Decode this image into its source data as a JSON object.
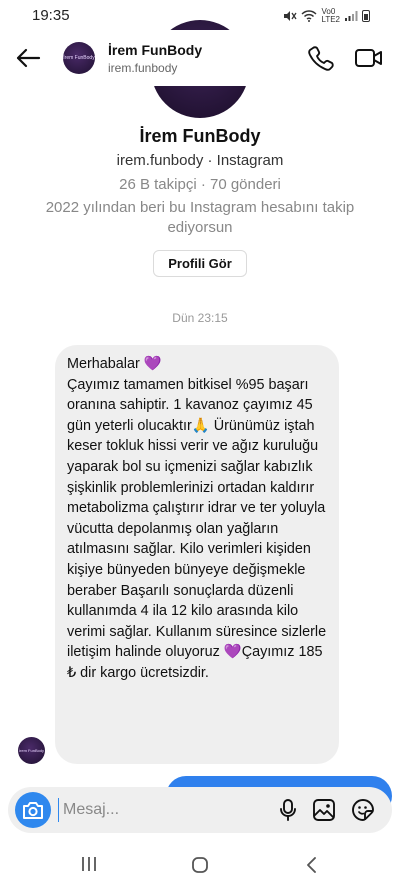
{
  "status_bar": {
    "time": "19:35",
    "network_top": "Vo0",
    "network_bottom": "LTE2"
  },
  "header": {
    "name": "İrem FunBody",
    "username": "irem.funbody",
    "avatar_text": "İrem FunBody",
    "icons": [
      "back-arrow-icon",
      "phone-icon",
      "video-camera-icon"
    ]
  },
  "profile": {
    "name": "İrem FunBody",
    "subtitle": "irem.funbody · Instagram",
    "stats": "26 B takipçi · 70 gönderi",
    "follow_since": "2022 yılından beri bu Instagram hesabını takip ediyorsun",
    "view_profile_label": "Profili Gör"
  },
  "conversation": {
    "timestamp": "Dün 23:15",
    "messages": [
      {
        "sender": "İrem FunBody",
        "text": "Merhabalar 💜\nÇayımız tamamen bitkisel %95 başarı oranına sahiptir. 1 kavanoz çayımız 45 gün yeterli olucaktır🙏 Ürünümüz   iştah keser tokluk hissi verir ve ağız kuruluğu yaparak bol su içmenizi sağlar kabızlık şişkinlik problemlerinizi ortadan kaldırır metabolizma çalıştırır idrar ve ter yoluyla vücutta depolanmış olan yağların atılmasını sağlar. Kilo verimleri kişiden kişiye bünyeden bünyeye değişmekle beraber Başarılı sonuçlarda düzenli kullanımda 4 ila 12 kilo arasında kilo verimi sağlar. Kullanım süresince sizlerle iletişim halinde oluyoruz 💜Çayımız 185 ₺ dir kargo ücretsizdir."
      }
    ]
  },
  "composer": {
    "placeholder": "Mesaj...",
    "value": "",
    "icons": [
      "camera-icon",
      "microphone-icon",
      "gallery-icon",
      "sticker-icon"
    ]
  },
  "colors": {
    "accent": "#2f88ee",
    "bubble_received": "#efefef",
    "bubble_sent": "#2f80ed"
  }
}
